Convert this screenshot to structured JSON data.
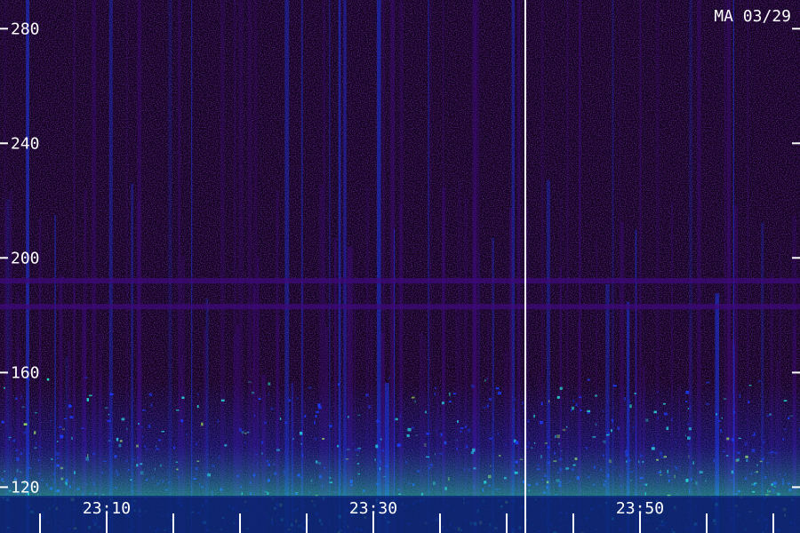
{
  "chart_data": {
    "type": "heatmap",
    "station_label": "MA 03/29",
    "y_ticks": [
      120,
      160,
      200,
      240,
      280
    ],
    "ylim": [
      104,
      290
    ],
    "x_ticks": [
      {
        "label": "23:10",
        "minute": 1390
      },
      {
        "label": "23:30",
        "minute": 1410
      },
      {
        "label": "23:50",
        "minute": 1430
      }
    ],
    "xlim": [
      1382,
      1442
    ],
    "marker_line_minute": 1421.4,
    "horizontal_bands": [
      192,
      183
    ],
    "colors": {
      "background": "#0a0014",
      "low": "#3d0a7a",
      "mid": "#1a3cff",
      "high": "#29e6d0",
      "peak": "#b4ff3c",
      "text": "#ffffff"
    }
  }
}
